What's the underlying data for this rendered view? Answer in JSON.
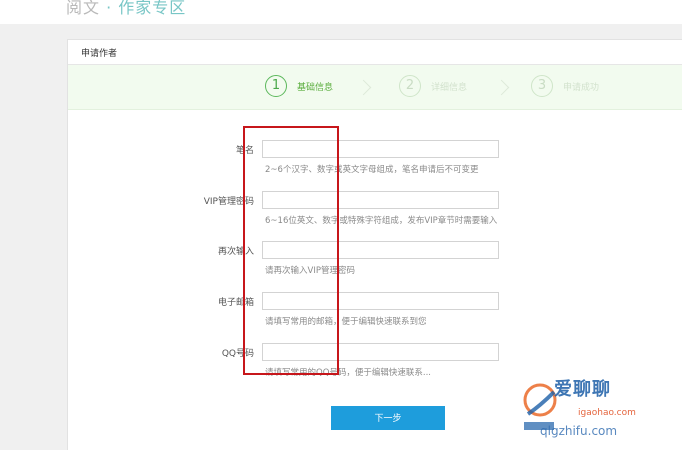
{
  "header": {
    "title_part1": "阅文",
    "title_sep": "·",
    "title_part2": "作家专区"
  },
  "panel": {
    "title": "申请作者"
  },
  "steps": [
    {
      "number": "1",
      "label": "基础信息",
      "active": true
    },
    {
      "number": "2",
      "label": "详细信息",
      "active": false
    },
    {
      "number": "3",
      "label": "申请成功",
      "active": false
    }
  ],
  "form": {
    "pen_name": {
      "label": "笔名",
      "value": "",
      "hint": "2~6个汉字、数字或英文字母组成，笔名申请后不可变更"
    },
    "vip_password": {
      "label": "VIP管理密码",
      "value": "",
      "hint": "6~16位英文、数字或特殊字符组成，发布VIP章节时需要输入"
    },
    "confirm_password": {
      "label": "再次输入",
      "value": "",
      "hint": "请再次输入VIP管理密码"
    },
    "email": {
      "label": "电子邮箱",
      "value": "",
      "hint": "请填写常用的邮箱，便于编辑快速联系到您"
    },
    "qq": {
      "label": "QQ号码",
      "value": "",
      "hint": "请填写常用的QQ号码，便于编辑快速联系..."
    }
  },
  "next_button": {
    "label": "下一步"
  },
  "watermark": {
    "brand": "爱聊聊",
    "site": "qlgzhifu.com",
    "sub": "igaohao.com"
  },
  "colors": {
    "accent": "#1e9ddc",
    "step_active": "#5cb85c",
    "highlight_box": "#c7161b"
  }
}
